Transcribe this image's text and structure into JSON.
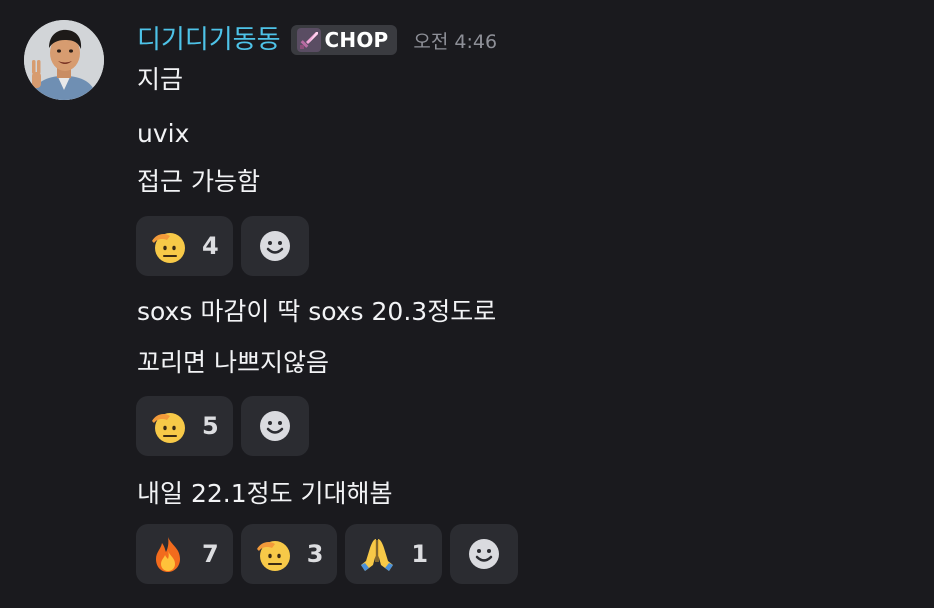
{
  "author": {
    "name": "디기디기동동",
    "tag_label": "CHOP",
    "tag_icon": "pink-sword-icon",
    "timestamp": "오전 4:46",
    "name_color": "#4ec3e8"
  },
  "messages": [
    {
      "text": "지금"
    },
    {
      "text": "uvix"
    },
    {
      "text": "접근 가능함"
    },
    {
      "text": "soxs 마감이 딱 soxs 20.3정도로"
    },
    {
      "text": "꼬리면 나쁘지않음"
    },
    {
      "text": "내일 22.1정도 기대해봄"
    }
  ],
  "reaction_groups": [
    {
      "reactions": [
        {
          "emoji": "saluting-face",
          "count": "4"
        }
      ],
      "add_icon": "add-reaction-smiley-icon"
    },
    {
      "reactions": [
        {
          "emoji": "saluting-face",
          "count": "5"
        }
      ],
      "add_icon": "add-reaction-smiley-icon"
    },
    {
      "reactions": [
        {
          "emoji": "fire",
          "count": "7"
        },
        {
          "emoji": "saluting-face",
          "count": "3"
        },
        {
          "emoji": "folded-hands",
          "count": "1"
        }
      ],
      "add_icon": "add-reaction-smiley-icon"
    }
  ]
}
